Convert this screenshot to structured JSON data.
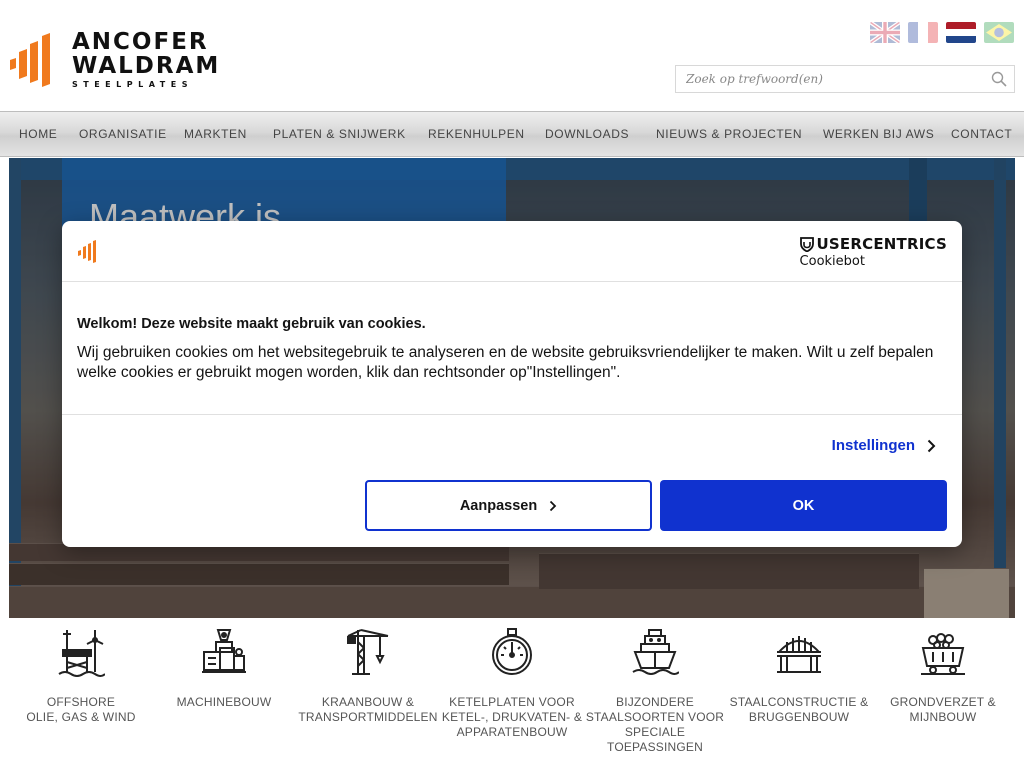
{
  "logo": {
    "line1": "ANCOFER",
    "line2": "WALDRAM",
    "line3": "STEELPLATES"
  },
  "languages": [
    "english-flag",
    "french-flag",
    "dutch-flag",
    "brazil-flag"
  ],
  "active_language": "dutch-flag",
  "search": {
    "placeholder": "Zoek op trefwoord(en)"
  },
  "nav": [
    "HOME",
    "ORGANISATIE",
    "MARKTEN",
    "PLATEN & SNIJWERK",
    "REKENHULPEN",
    "DOWNLOADS",
    "NIEUWS & PROJECTEN",
    "WERKEN BIJ AWS",
    "CONTACT"
  ],
  "hero": {
    "title": "Maatwerk is"
  },
  "cookie": {
    "brand_line1": "USERCENTRICS",
    "brand_line2": "Cookiebot",
    "title": "Welkom! Deze website maakt gebruik van cookies.",
    "text": "Wij gebruiken cookies om het websitegebruik te analyseren en de website gebruiksvriendelijker te maken. Wilt u zelf bepalen welke cookies er gebruikt mogen worden, klik dan rechtsonder op\"Instellingen\".",
    "settings_label": "Instellingen",
    "customize_label": "Aanpassen",
    "ok_label": "OK"
  },
  "markets": [
    {
      "label": "OFFSHORE\nOLIE, GAS & WIND",
      "icon": "offshore-platform-icon"
    },
    {
      "label": "MACHINEBOUW",
      "icon": "machine-icon"
    },
    {
      "label": "KRAANBOUW &\nTRANSPORTMIDDELEN",
      "icon": "crane-icon"
    },
    {
      "label": "KETELPLATEN VOOR\nKETEL-, DRUKVATEN- &\nAPPARATENBOUW",
      "icon": "pressure-gauge-icon"
    },
    {
      "label": "BIJZONDERE\nSTAALSOORTEN VOOR\nSPECIALE\nTOEPASSINGEN",
      "icon": "ship-icon"
    },
    {
      "label": "STAALCONSTRUCTIE &\nBRUGGENBOUW",
      "icon": "bridge-icon"
    },
    {
      "label": "GRONDVERZET &\nMIJNBOUW",
      "icon": "mine-cart-icon"
    }
  ],
  "colors": {
    "accent_orange": "#f07a1e",
    "cookie_blue": "#1032cf",
    "hero_blue": "#1e6ebe"
  }
}
